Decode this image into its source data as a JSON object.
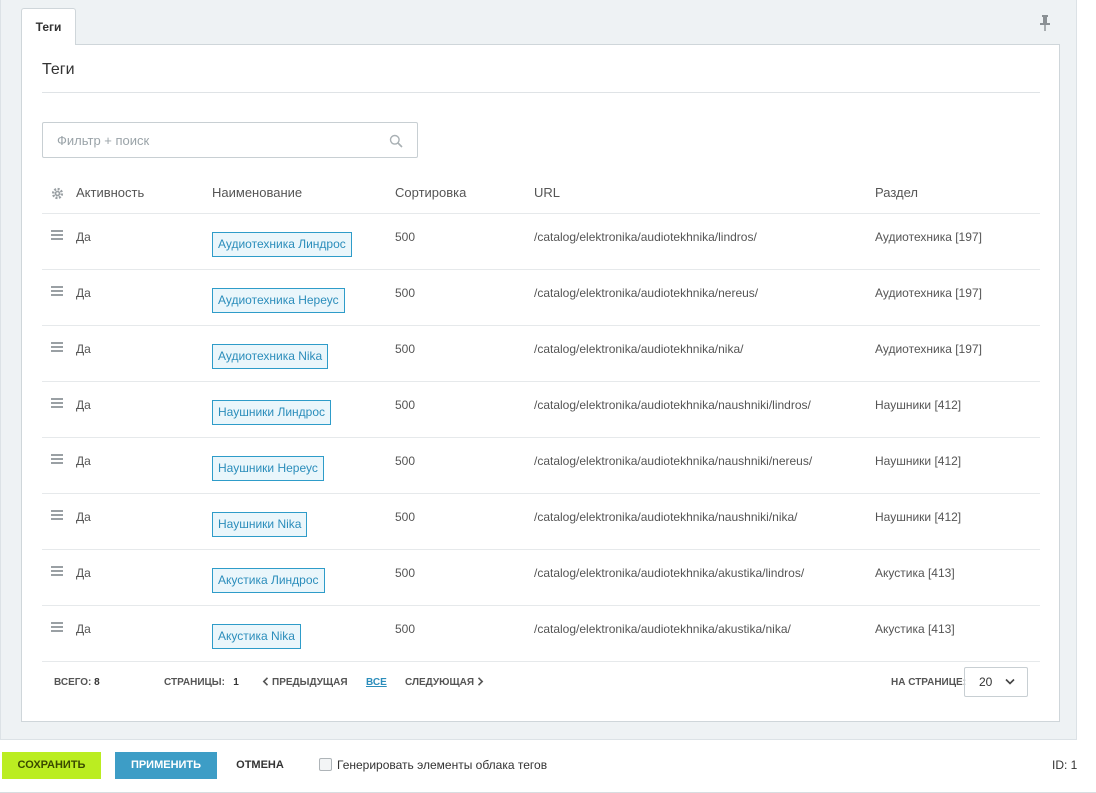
{
  "tab": {
    "label": "Теги"
  },
  "panel": {
    "title": "Теги"
  },
  "search": {
    "placeholder": "Фильтр + поиск"
  },
  "table": {
    "headers": {
      "activity": "Активность",
      "name": "Наименование",
      "sort": "Сортировка",
      "url": "URL",
      "section": "Раздел"
    },
    "rows": [
      {
        "activity": "Да",
        "name": "Аудиотехника Линдрос",
        "sort": "500",
        "url": "/catalog/elektronika/audiotekhnika/lindros/",
        "section": "Аудиотехника [197]"
      },
      {
        "activity": "Да",
        "name": "Аудиотехника Нереус",
        "sort": "500",
        "url": "/catalog/elektronika/audiotekhnika/nereus/",
        "section": "Аудиотехника [197]"
      },
      {
        "activity": "Да",
        "name": "Аудиотехника Nika",
        "sort": "500",
        "url": "/catalog/elektronika/audiotekhnika/nika/",
        "section": "Аудиотехника [197]"
      },
      {
        "activity": "Да",
        "name": "Наушники Линдрос",
        "sort": "500",
        "url": "/catalog/elektronika/audiotekhnika/naushniki/lindros/",
        "section": "Наушники [412]"
      },
      {
        "activity": "Да",
        "name": "Наушники Нереус",
        "sort": "500",
        "url": "/catalog/elektronika/audiotekhnika/naushniki/nereus/",
        "section": "Наушники [412]"
      },
      {
        "activity": "Да",
        "name": "Наушники Nika",
        "sort": "500",
        "url": "/catalog/elektronika/audiotekhnika/naushniki/nika/",
        "section": "Наушники [412]"
      },
      {
        "activity": "Да",
        "name": "Акустика Линдрос",
        "sort": "500",
        "url": "/catalog/elektronika/audiotekhnika/akustika/lindros/",
        "section": "Акустика [413]"
      },
      {
        "activity": "Да",
        "name": "Акустика Nika",
        "sort": "500",
        "url": "/catalog/elektronika/audiotekhnika/akustika/nika/",
        "section": "Акустика [413]"
      }
    ]
  },
  "pager": {
    "total_label": "ВСЕГО:",
    "total": "8",
    "pages_label": "СТРАНИЦЫ:",
    "page": "1",
    "prev": "ПРЕДЫДУЩАЯ",
    "all": "ВСЕ",
    "next": "СЛЕДУЮЩАЯ",
    "per_page_label": "НА СТРАНИЦЕ:",
    "per_page": "20"
  },
  "footer": {
    "save": "СОХРАНИТЬ",
    "apply": "ПРИМЕНИТЬ",
    "cancel": "ОТМЕНА",
    "generate_label": "Генерировать элементы облака тегов",
    "id_label": "ID: 1"
  },
  "colors": {
    "accent": "#2b8dbb",
    "save": "#bbed21",
    "apply": "#3d9dc6"
  }
}
